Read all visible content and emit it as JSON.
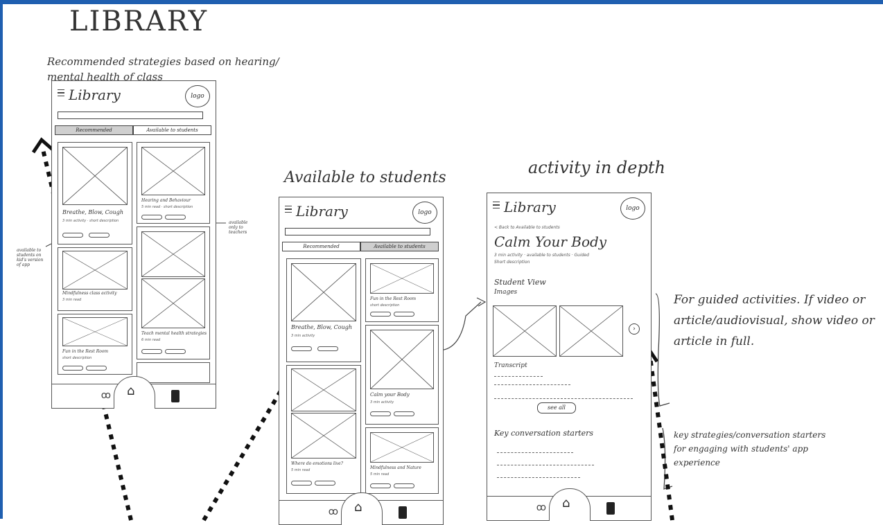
{
  "page_title": "LIBRARY",
  "left_note": "Recommended strategies based on hearing/ mental health of class",
  "panel2_title": "Available to students",
  "panel3_title": "activity in depth",
  "side_note_left": "available to students on kid's version of app",
  "side_note_teachers": "available only to teachers",
  "guided_note": "For guided activities. If video or article/audiovisual, show video or article in full.",
  "key_note": "key strategies/conversation starters for engaging with students' app experience",
  "phone": {
    "title": "Library",
    "logo": "logo",
    "tabs": [
      "Recommended",
      "Available to students"
    ]
  },
  "phone1_cards": [
    {
      "title": "Breathe, Blow, Cough",
      "meta": "3 min activity · short description"
    },
    {
      "title": "Hearing and Behaviour",
      "meta": "5 min read · short description"
    },
    {
      "title": "Mindfulness class activity",
      "meta": "3 min read"
    },
    {
      "title": "Teach mental health strategies",
      "meta": "6 min read"
    },
    {
      "title": "Fun in the Rest Room",
      "meta": "short description"
    }
  ],
  "phone2_cards": [
    {
      "title": "Breathe, Blow, Cough",
      "meta": "3 min activity"
    },
    {
      "title": "Fun in the Rest Room",
      "meta": "short description"
    },
    {
      "title": "Calm your Body",
      "meta": "3 min activity"
    },
    {
      "title": "Where do emotions live?",
      "meta": "5 min read"
    },
    {
      "title": "Mindfulness and Nature",
      "meta": "5 min read"
    }
  ],
  "detail": {
    "back": "< Back to Available to students",
    "title": "Calm Your Body",
    "meta": "3 min activity · available to students · Guided",
    "desc": "Short description",
    "student_view": "Student View",
    "images": "Images",
    "transcript": "Transcript",
    "see_all": "see all",
    "key_starters": "Key conversation starters"
  }
}
